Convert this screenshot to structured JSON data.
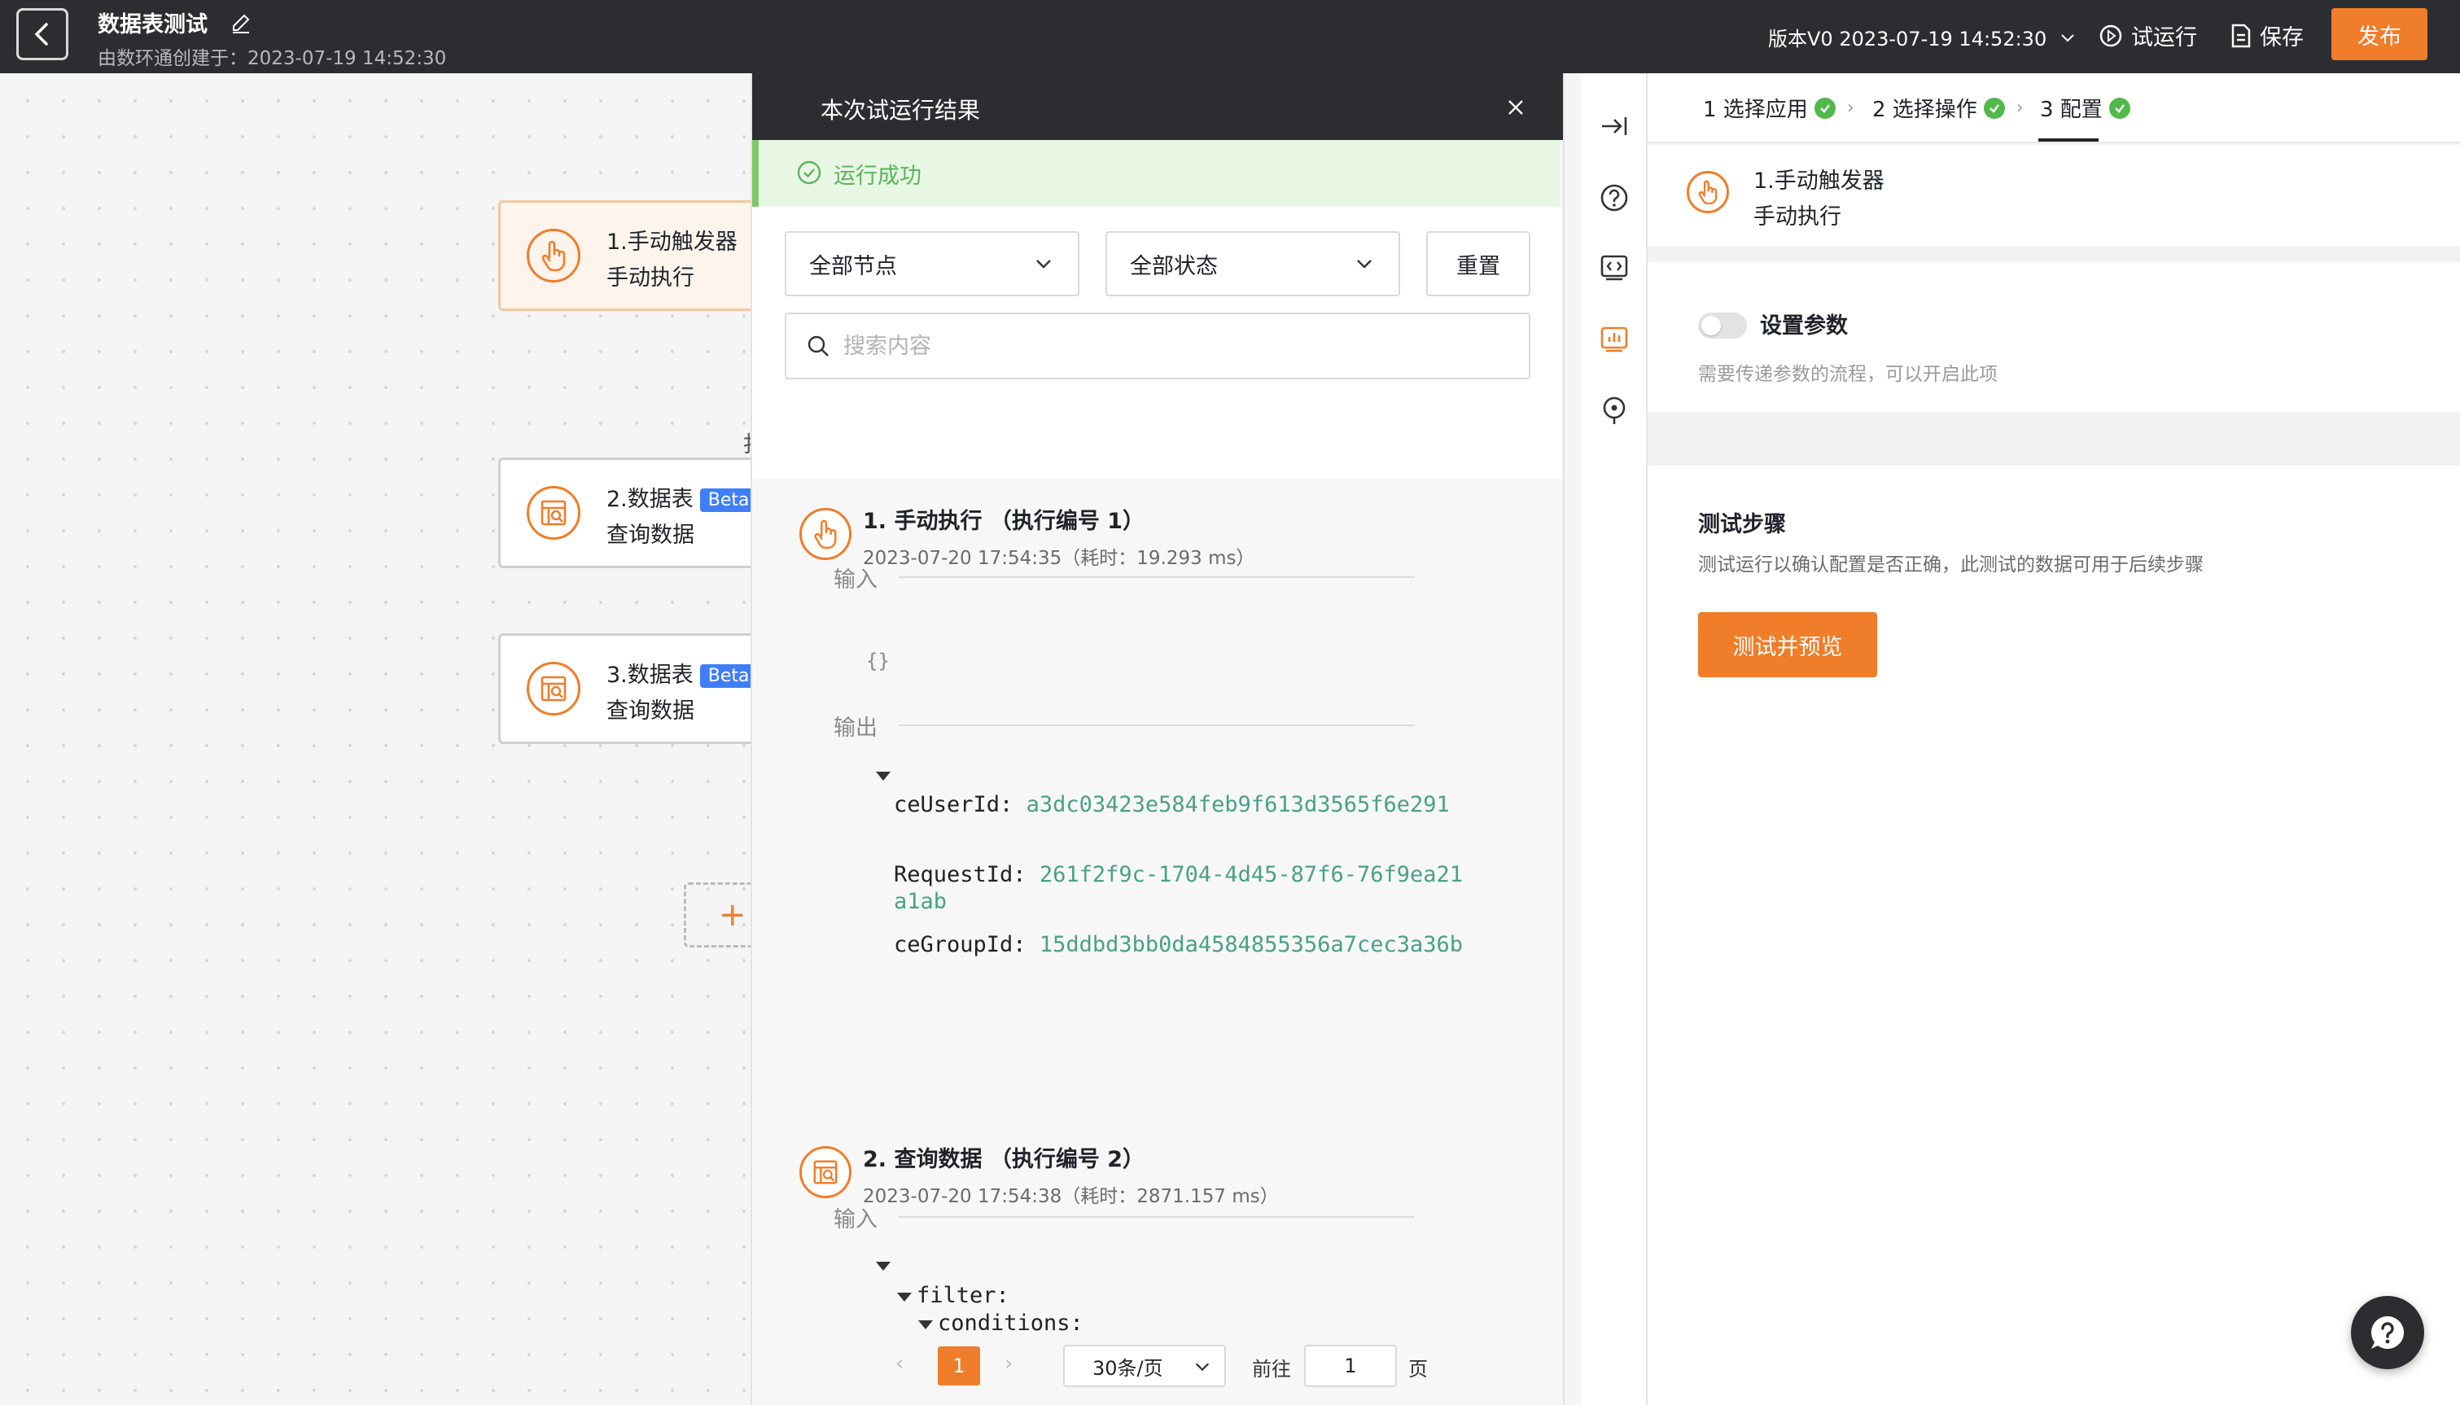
{
  "topbar": {
    "title": "数据表测试",
    "subtitle": "由数环通创建于：2023-07-19 14:52:30",
    "version": "版本V0 2023-07-19 14:52:30",
    "trial_run": "试运行",
    "save": "保存",
    "publish": "发布"
  },
  "canvas": {
    "nodes": [
      {
        "title": "1.手动触发器",
        "sub": "手动执行"
      },
      {
        "title": "2.数据表",
        "badge": "Beta",
        "sub": "查询数据"
      },
      {
        "title": "3.数据表",
        "badge": "Beta",
        "sub": "查询数据"
      }
    ],
    "partial_char": "扌"
  },
  "result_panel": {
    "title": "本次试运行结果",
    "status": "运行成功",
    "node_filter": "全部节点",
    "status_filter": "全部状态",
    "reset": "重置",
    "search_placeholder": "搜索内容",
    "steps": [
      {
        "title": "1. 手动执行 （执行编号 1）",
        "meta": "2023-07-20 17:54:35（耗时：19.293 ms）",
        "input_label": "输入",
        "input_value": "{}",
        "output_label": "输出",
        "output": [
          {
            "key": "ceUserId:",
            "value": "a3dc03423e584feb9f613d3565f6e291"
          },
          {
            "key": "RequestId:",
            "value": "261f2f9c-1704-4d45-87f6-76f9ea21a1ab"
          },
          {
            "key": "ceGroupId:",
            "value": "15ddbd3bb0da4584855356a7cec3a36b"
          }
        ]
      },
      {
        "title": "2. 查询数据 （执行编号 2）",
        "meta": "2023-07-20 17:54:38（耗时：2871.157 ms）",
        "input_label": "输入",
        "tree": [
          "filter:",
          "conditions:"
        ]
      }
    ],
    "pager": {
      "prev": "‹",
      "next": "›",
      "current": "1",
      "page_size": "30条/页",
      "goto": "前往",
      "goto_value": "1",
      "page_unit": "页"
    }
  },
  "config": {
    "steps": [
      {
        "label": "1 选择应用"
      },
      {
        "label": "2 选择操作"
      },
      {
        "label": "3 配置"
      }
    ],
    "trigger_title": "1.手动触发器",
    "trigger_sub": "手动执行",
    "param_title": "设置参数",
    "param_desc": "需要传递参数的流程，可以开启此项",
    "test_title": "测试步骤",
    "test_desc": "测试运行以确认配置是否正确，此测试的数据可用于后续步骤",
    "test_button": "测试并预览"
  },
  "colors": {
    "accent": "#ef7d2a",
    "success": "#52b84a",
    "topbar": "#2c2d30"
  }
}
